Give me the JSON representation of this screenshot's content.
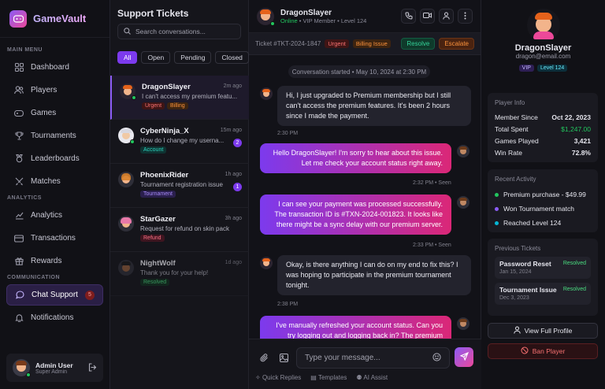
{
  "app": {
    "name": "GameVault"
  },
  "sidebar": {
    "main_menu_label": "MAIN MENU",
    "analytics_label": "ANALYTICS",
    "communication_label": "COMMUNICATION",
    "items": [
      {
        "label": "Dashboard",
        "icon": "grid-icon"
      },
      {
        "label": "Players",
        "icon": "users-icon"
      },
      {
        "label": "Games",
        "icon": "gamepad-icon"
      },
      {
        "label": "Tournaments",
        "icon": "trophy-icon"
      },
      {
        "label": "Leaderboards",
        "icon": "medal-icon"
      },
      {
        "label": "Matches",
        "icon": "swords-icon"
      },
      {
        "label": "Analytics",
        "icon": "chart-icon"
      },
      {
        "label": "Transactions",
        "icon": "card-icon"
      },
      {
        "label": "Rewards",
        "icon": "gift-icon"
      },
      {
        "label": "Chat Support",
        "icon": "chat-icon",
        "badge": "5",
        "active": true
      },
      {
        "label": "Notifications",
        "icon": "bell-icon"
      }
    ],
    "user": {
      "name": "Admin User",
      "role": "Super Admin"
    }
  },
  "tickets": {
    "title": "Support Tickets",
    "search_placeholder": "Search conversations...",
    "filters": [
      "All",
      "Open",
      "Pending",
      "Closed"
    ],
    "items": [
      {
        "name": "DragonSlayer",
        "time": "2m ago",
        "message": "I can't access my premium featu...",
        "tags": [
          "Urgent",
          "Billing"
        ]
      },
      {
        "name": "CyberNinja_X",
        "time": "15m ago",
        "message": "How do I change my userna...",
        "tags": [
          "Account"
        ],
        "unread": "2"
      },
      {
        "name": "PhoenixRider",
        "time": "1h ago",
        "message": "Tournament registration issue",
        "tags": [
          "Tournament"
        ],
        "unread": "1"
      },
      {
        "name": "StarGazer",
        "time": "3h ago",
        "message": "Request for refund on skin pack",
        "tags": [
          "Refund"
        ]
      },
      {
        "name": "NightWolf",
        "time": "1d ago",
        "message": "Thank you for your help!",
        "tags": [
          "Resolved"
        ]
      }
    ]
  },
  "chat": {
    "name": "DragonSlayer",
    "status": "Online",
    "meta": "• VIP Member • Level 124",
    "ticket_id": "Ticket #TKT-2024-1847",
    "ticket_tags": [
      "Urgent",
      "Billing Issue"
    ],
    "resolve_label": "Resolve",
    "escalate_label": "Escalate",
    "system_message": "Conversation started • May 10, 2024 at 2:30 PM",
    "messages": [
      {
        "text": "Hi, I just upgraded to Premium membership but I still can't access the premium features. It's been 2 hours since I made the payment.",
        "time": "2:30 PM"
      },
      {
        "text": "Hello DragonSlayer! I'm sorry to hear about this issue. Let me check your account status right away.",
        "time": "2:32 PM • Seen"
      },
      {
        "text": "I can see your payment was processed successfully. The transaction ID is #TXN-2024-001823. It looks like there might be a sync delay with our premium server.",
        "time": "2:33 PM • Seen"
      },
      {
        "text": "Okay, is there anything I can do on my end to fix this? I was hoping to participate in the premium tournament tonight.",
        "time": "2:38 PM"
      },
      {
        "text": "I've manually refreshed your account status. Can you try logging out and logging back in? The premium",
        "time": ""
      }
    ],
    "input_placeholder": "Type your message...",
    "quick": [
      "Quick Replies",
      "Templates",
      "AI Assist"
    ]
  },
  "profile": {
    "name": "DragonSlayer",
    "email": "dragon@email.com",
    "badges": [
      "VIP",
      "Level 124"
    ],
    "info_title": "Player Info",
    "info": [
      {
        "label": "Member Since",
        "value": "Oct 22, 2023"
      },
      {
        "label": "Total Spent",
        "value": "$1,247.00"
      },
      {
        "label": "Games Played",
        "value": "3,421"
      },
      {
        "label": "Win Rate",
        "value": "72.8%"
      }
    ],
    "activity_title": "Recent Activity",
    "activity": [
      {
        "text": "Premium purchase - $49.99",
        "color": "#22c55e"
      },
      {
        "text": "Won Tournament match",
        "color": "#8b5cf6"
      },
      {
        "text": "Reached Level 124",
        "color": "#06b6d4"
      }
    ],
    "previous_title": "Previous Tickets",
    "previous": [
      {
        "title": "Password Reset",
        "date": "Jan 15, 2024",
        "status": "Resolved"
      },
      {
        "title": "Tournament Issue",
        "date": "Dec 3, 2023",
        "status": "Resolved"
      }
    ],
    "view_profile_label": "View Full Profile",
    "ban_label": "Ban Player"
  }
}
